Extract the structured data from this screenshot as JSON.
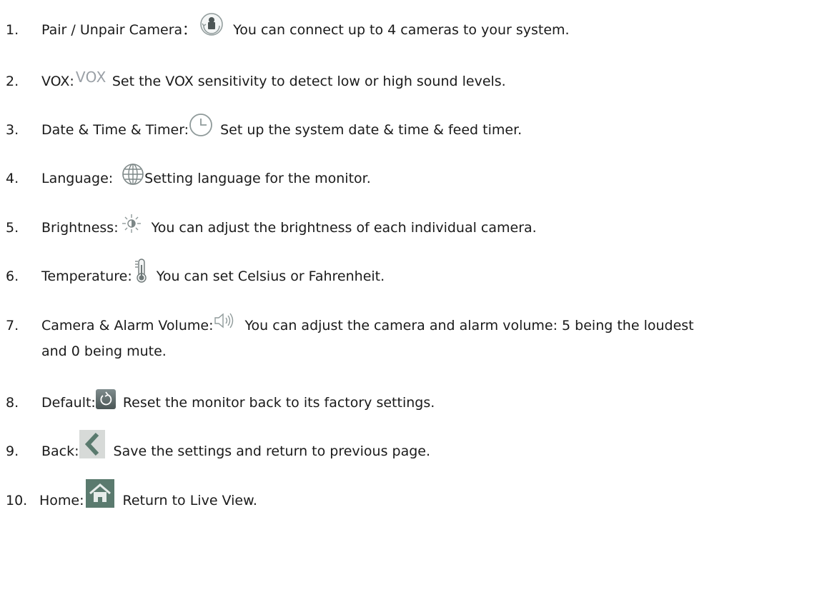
{
  "items": [
    {
      "num": "1.",
      "label": "Pair / Unpair Camera：",
      "icon": "camera-pair-icon",
      "text": "You can connect up to 4 cameras to your system."
    },
    {
      "num": "2.",
      "label": "VOX:",
      "icon_text": "VOX",
      "icon": "vox-icon",
      "text": "Set the VOX sensitivity to detect low or high sound levels."
    },
    {
      "num": "3.",
      "label": "Date & Time & Timer:",
      "icon": "clock-icon",
      "text": "Set up the system date & time & feed timer."
    },
    {
      "num": "4.",
      "label": "Language:",
      "icon": "globe-icon",
      "text": "Setting language for the monitor."
    },
    {
      "num": "5.",
      "label": "Brightness:",
      "icon": "sun-icon",
      "text": "You can adjust the brightness of each individual camera."
    },
    {
      "num": "6.",
      "label": "Temperature:",
      "icon": "thermometer-icon",
      "text": "You can set Celsius or Fahrenheit."
    },
    {
      "num": "7.",
      "label": "Camera & Alarm Volume:",
      "icon": "speaker-icon",
      "text": "You can adjust the camera and alarm volume: 5 being the loudest",
      "text_cont": "and 0 being mute."
    },
    {
      "num": "8.",
      "label": "Default:",
      "icon": "reset-icon",
      "text": "Reset the monitor back to its factory settings."
    },
    {
      "num": "9.",
      "label": "Back:",
      "icon": "back-arrow-icon",
      "text": "Save the settings and return to previous page."
    },
    {
      "num": "10.",
      "label": "Home:",
      "icon": "home-icon",
      "text": "Return to Live View."
    }
  ],
  "colors": {
    "text": "#1a1a1a",
    "icon_gray": "#9aa0a6",
    "icon_dark": "#5f6a6a",
    "button_green": "#5a7a6e"
  }
}
